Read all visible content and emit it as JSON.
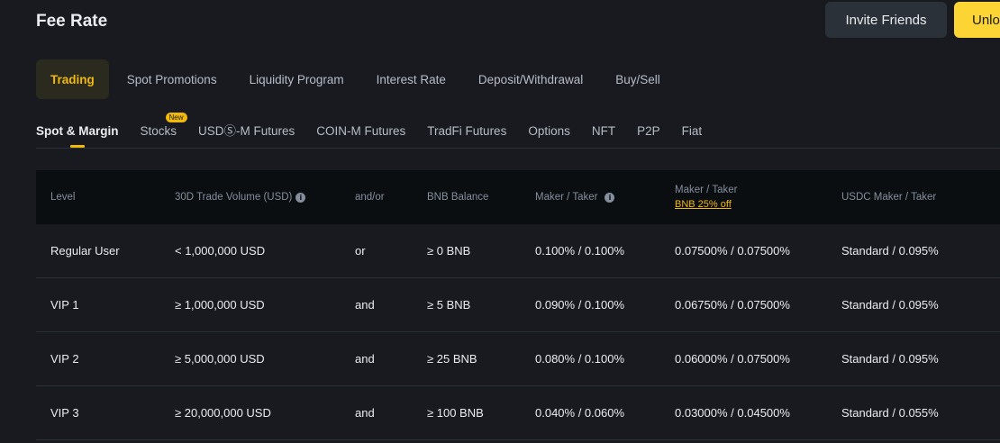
{
  "header": {
    "title": "Fee Rate",
    "invite_label": "Invite Friends",
    "unlock_label": "Unlock"
  },
  "main_tabs": [
    {
      "label": "Trading",
      "active": true
    },
    {
      "label": "Spot Promotions"
    },
    {
      "label": "Liquidity Program"
    },
    {
      "label": "Interest Rate"
    },
    {
      "label": "Deposit/Withdrawal"
    },
    {
      "label": "Buy/Sell"
    }
  ],
  "sub_tabs": [
    {
      "label": "Spot & Margin",
      "active": true
    },
    {
      "label": "Stocks",
      "badge": "New"
    },
    {
      "label": "USDⓈ-M Futures"
    },
    {
      "label": "COIN-M Futures"
    },
    {
      "label": "TradFi Futures"
    },
    {
      "label": "Options"
    },
    {
      "label": "NFT"
    },
    {
      "label": "P2P"
    },
    {
      "label": "Fiat"
    }
  ],
  "table": {
    "headers": {
      "level": "Level",
      "volume": "30D Trade Volume (USD)",
      "andor": "and/or",
      "bnb": "BNB Balance",
      "maker_taker": "Maker / Taker",
      "maker_taker_bnb": "Maker / Taker",
      "bnb_discount": "BNB 25% off",
      "usdc": "USDC Maker / Taker"
    },
    "rows": [
      {
        "level": "Regular User",
        "volume": "< 1,000,000 USD",
        "andor": "or",
        "bnb": "≥ 0 BNB",
        "mt": "0.100% / 0.100%",
        "mtb": "0.07500% / 0.07500%",
        "usdc": "Standard / 0.095%"
      },
      {
        "level": "VIP 1",
        "volume": "≥ 1,000,000 USD",
        "andor": "and",
        "bnb": "≥ 5 BNB",
        "mt": "0.090% / 0.100%",
        "mtb": "0.06750% / 0.07500%",
        "usdc": "Standard / 0.095%"
      },
      {
        "level": "VIP 2",
        "volume": "≥ 5,000,000 USD",
        "andor": "and",
        "bnb": "≥ 25 BNB",
        "mt": "0.080% / 0.100%",
        "mtb": "0.06000% / 0.07500%",
        "usdc": "Standard / 0.095%"
      },
      {
        "level": "VIP 3",
        "volume": "≥ 20,000,000 USD",
        "andor": "and",
        "bnb": "≥ 100 BNB",
        "mt": "0.040% / 0.060%",
        "mtb": "0.03000% / 0.04500%",
        "usdc": "Standard / 0.055%"
      }
    ]
  },
  "colors": {
    "background": "#181a20",
    "accent": "#f0b90b",
    "button_primary": "#fcd535",
    "button_secondary": "#2b3139"
  }
}
